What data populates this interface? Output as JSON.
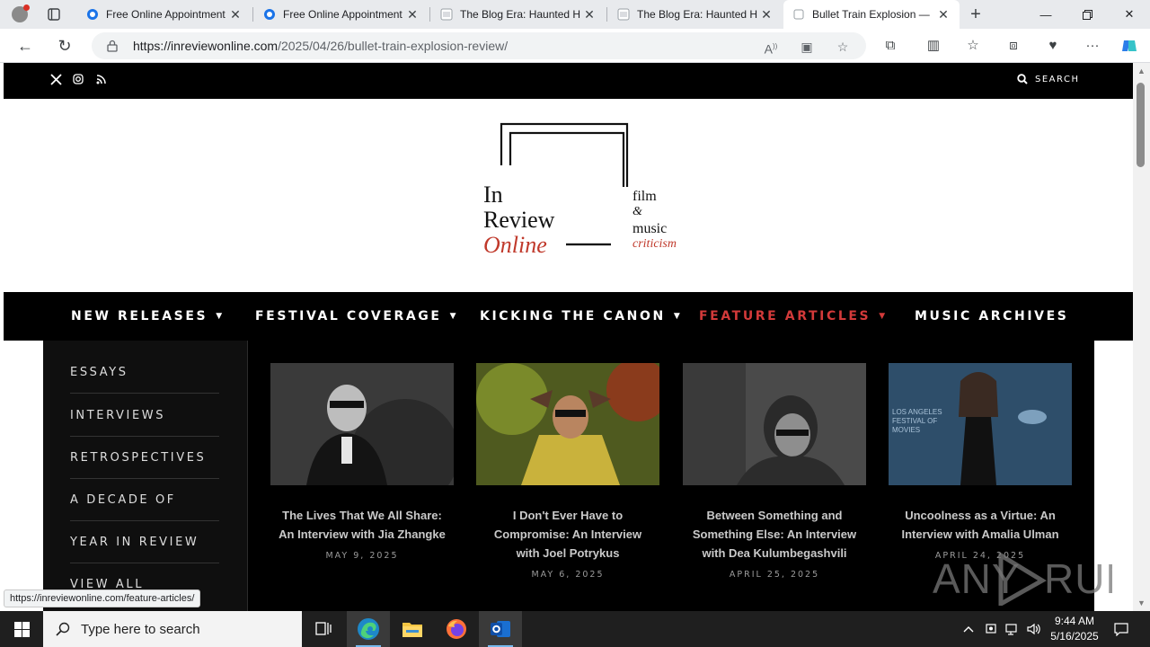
{
  "browser": {
    "tabs": [
      {
        "title": "Free Online Appointment",
        "favicon": "blue-globe"
      },
      {
        "title": "Free Online Appointment",
        "favicon": "blue-globe"
      },
      {
        "title": "The Blog Era: Haunted H",
        "favicon": "page"
      },
      {
        "title": "The Blog Era: Haunted H",
        "favicon": "page"
      },
      {
        "title": "Bullet Train Explosion —",
        "favicon": "page-loading",
        "active": true
      }
    ],
    "url_domain": "https://inreviewonline.com",
    "url_path": "/2025/04/26/bullet-train-explosion-review/",
    "status_url": "https://inreviewonline.com/feature-articles/"
  },
  "site": {
    "search_label": "SEARCH",
    "logo": {
      "line1": "In",
      "line2": "Review",
      "line3": "Online",
      "tag1": "film",
      "tag2": "&",
      "tag3": "music",
      "tag4": "criticism"
    },
    "nav": [
      {
        "label": "NEW RELEASES",
        "has_dropdown": true
      },
      {
        "label": "FESTIVAL COVERAGE",
        "has_dropdown": true
      },
      {
        "label": "KICKING THE CANON",
        "has_dropdown": true
      },
      {
        "label": "FEATURE ARTICLES",
        "has_dropdown": true,
        "active": true
      },
      {
        "label": "MUSIC ARCHIVES",
        "has_dropdown": false
      }
    ],
    "submenu": [
      "ESSAYS",
      "INTERVIEWS",
      "RETROSPECTIVES",
      "A DECADE OF",
      "YEAR IN REVIEW",
      "VIEW ALL"
    ],
    "cards": [
      {
        "title": "The Lives That We All Share: An Interview with Jia Zhangke",
        "date": "MAY 9, 2025"
      },
      {
        "title": "I Don't Ever Have to Compromise: An Interview with Joel Potrykus",
        "date": "MAY 6, 2025"
      },
      {
        "title": "Between Something and Something Else: An Interview with Dea Kulumbegashvili",
        "date": "APRIL 25, 2025"
      },
      {
        "title": "Uncoolness as a Virtue: An Interview with Amalia Ulman",
        "date": "APRIL 24, 2025"
      }
    ],
    "card4_image_text": "LOS ANGELES FESTIVAL OF MOVIES"
  },
  "watermark": "ANY RUN",
  "taskbar": {
    "search_placeholder": "Type here to search",
    "time": "9:44 AM",
    "date": "5/16/2025"
  },
  "colors": {
    "accent_red": "#d33a3a",
    "nav_bg": "#000000",
    "logo_red": "#c0392b"
  }
}
